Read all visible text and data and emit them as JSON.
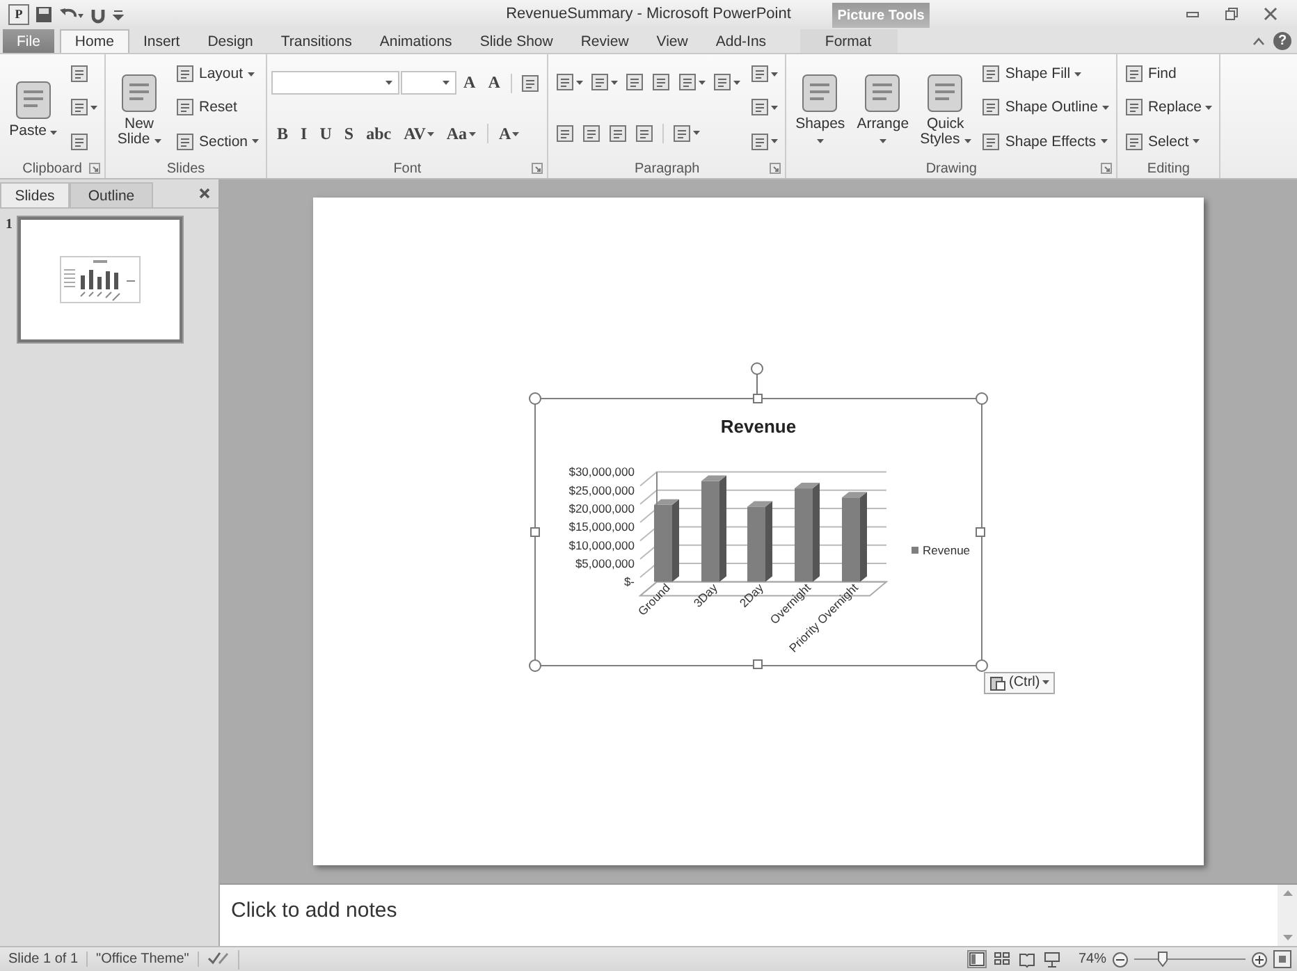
{
  "window": {
    "app_icon": "P",
    "title": "RevenueSummary - Microsoft PowerPoint",
    "context_label": "Picture Tools"
  },
  "tabs": [
    {
      "label": "File",
      "kind": "file",
      "selected": false
    },
    {
      "label": "Home",
      "kind": "normal",
      "selected": true
    },
    {
      "label": "Insert",
      "kind": "normal",
      "selected": false
    },
    {
      "label": "Design",
      "kind": "normal",
      "selected": false
    },
    {
      "label": "Transitions",
      "kind": "normal",
      "selected": false
    },
    {
      "label": "Animations",
      "kind": "normal",
      "selected": false
    },
    {
      "label": "Slide Show",
      "kind": "normal",
      "selected": false
    },
    {
      "label": "Review",
      "kind": "normal",
      "selected": false
    },
    {
      "label": "View",
      "kind": "normal",
      "selected": false
    },
    {
      "label": "Add-Ins",
      "kind": "normal",
      "selected": false
    },
    {
      "label": "Format",
      "kind": "contextual",
      "selected": false
    }
  ],
  "help": "?",
  "ribbon": {
    "groups": [
      {
        "label": "Clipboard",
        "launcher": true,
        "columns": [
          [
            [
              {
                "kind": "large",
                "label": "Paste",
                "dropdown": true
              }
            ]
          ],
          [
            [
              {
                "kind": "icon",
                "dropdown": false
              }
            ],
            [
              {
                "kind": "icon",
                "dropdown": true
              }
            ],
            [
              {
                "kind": "icon",
                "dropdown": false
              }
            ]
          ]
        ]
      },
      {
        "label": "Slides",
        "launcher": false,
        "columns": [
          [
            [
              {
                "kind": "large",
                "label": "New Slide",
                "dropdown": true
              }
            ]
          ],
          [
            [
              {
                "kind": "small",
                "label": "Layout",
                "dropdown": true
              }
            ],
            [
              {
                "kind": "small",
                "label": "Reset",
                "dropdown": false
              }
            ],
            [
              {
                "kind": "small",
                "label": "Section",
                "dropdown": true
              }
            ]
          ]
        ]
      },
      {
        "label": "Font",
        "launcher": true,
        "columns": [
          [
            [
              {
                "kind": "field",
                "dropdown": true
              },
              {
                "kind": "field",
                "dropdown": true
              },
              {
                "kind": "glyph",
                "glyph": "A",
                "dropdown": false
              },
              {
                "kind": "glyph",
                "glyph": "A",
                "dropdown": false
              },
              {
                "kind": "separator"
              },
              {
                "kind": "icon",
                "dropdown": false
              }
            ],
            [
              {
                "kind": "glyph",
                "glyph": "B",
                "dropdown": false
              },
              {
                "kind": "glyph",
                "glyph": "I",
                "dropdown": false
              },
              {
                "kind": "glyph",
                "glyph": "U",
                "dropdown": false
              },
              {
                "kind": "glyph",
                "glyph": "S",
                "dropdown": false
              },
              {
                "kind": "glyph",
                "glyph": "abc",
                "dropdown": false
              },
              {
                "kind": "glyph",
                "glyph": "AV",
                "dropdown": true
              },
              {
                "kind": "glyph",
                "glyph": "Aa",
                "dropdown": true
              },
              {
                "kind": "separator"
              },
              {
                "kind": "glyph",
                "glyph": "A",
                "dropdown": true
              }
            ]
          ]
        ]
      },
      {
        "label": "Paragraph",
        "launcher": true,
        "columns": [
          [
            [
              {
                "kind": "icon",
                "dropdown": true
              },
              {
                "kind": "icon",
                "dropdown": true
              },
              {
                "kind": "icon",
                "dropdown": false
              },
              {
                "kind": "icon",
                "dropdown": false
              },
              {
                "kind": "icon",
                "dropdown": true
              },
              {
                "kind": "icon",
                "dropdown": true
              }
            ],
            [
              {
                "kind": "icon",
                "dropdown": false
              },
              {
                "kind": "icon",
                "dropdown": false
              },
              {
                "kind": "icon",
                "dropdown": false
              },
              {
                "kind": "icon",
                "dropdown": false
              },
              {
                "kind": "separator"
              },
              {
                "kind": "icon",
                "dropdown": true
              }
            ]
          ],
          [
            [
              {
                "kind": "icon",
                "dropdown": true
              }
            ],
            [
              {
                "kind": "icon",
                "dropdown": true
              }
            ],
            [
              {
                "kind": "icon",
                "dropdown": true
              }
            ]
          ]
        ]
      },
      {
        "label": "Drawing",
        "launcher": true,
        "columns": [
          [
            [
              {
                "kind": "large",
                "label": "Shapes",
                "dropdown": true
              }
            ]
          ],
          [
            [
              {
                "kind": "large",
                "label": "Arrange",
                "dropdown": true
              }
            ]
          ],
          [
            [
              {
                "kind": "large",
                "label": "Quick Styles",
                "dropdown": true
              }
            ]
          ],
          [
            [
              {
                "kind": "small",
                "label": "Shape Fill",
                "dropdown": true
              }
            ],
            [
              {
                "kind": "small",
                "label": "Shape Outline",
                "dropdown": true
              }
            ],
            [
              {
                "kind": "small",
                "label": "Shape Effects",
                "dropdown": true
              }
            ]
          ]
        ]
      },
      {
        "label": "Editing",
        "launcher": false,
        "columns": [
          [
            [
              {
                "kind": "small",
                "label": "Find",
                "dropdown": false
              }
            ],
            [
              {
                "kind": "small",
                "label": "Replace",
                "dropdown": true
              }
            ],
            [
              {
                "kind": "small",
                "label": "Select",
                "dropdown": true
              }
            ]
          ]
        ]
      }
    ]
  },
  "slide_pane": {
    "tabs": [
      {
        "label": "Slides",
        "selected": true
      },
      {
        "label": "Outline",
        "selected": false
      }
    ],
    "thumbnails": [
      {
        "number": "1",
        "selected": true
      }
    ]
  },
  "chart": {
    "paste_options": "(Ctrl)",
    "chart_data": {
      "type": "bar",
      "title": "Revenue",
      "categories": [
        "Ground",
        "3Day",
        "2Day",
        "Overnight",
        "Priority Overnight"
      ],
      "series": [
        {
          "name": "Revenue",
          "color": "#7f7f7f",
          "values": [
            21000000,
            27500000,
            20500000,
            25500000,
            23000000
          ]
        }
      ],
      "ylim": [
        0,
        30000000
      ],
      "yticks": [
        {
          "value": 0,
          "label": "$-"
        },
        {
          "value": 5000000,
          "label": "$5,000,000"
        },
        {
          "value": 10000000,
          "label": "$10,000,000"
        },
        {
          "value": 15000000,
          "label": "$15,000,000"
        },
        {
          "value": 20000000,
          "label": "$20,000,000"
        },
        {
          "value": 25000000,
          "label": "$25,000,000"
        },
        {
          "value": 30000000,
          "label": "$30,000,000"
        }
      ]
    }
  },
  "notes": {
    "placeholder": "Click to add notes"
  },
  "status_bar": {
    "slide": "Slide 1 of 1",
    "theme": "\"Office Theme\"",
    "views": [
      {
        "kind": "normal",
        "selected": true
      },
      {
        "kind": "sorter",
        "selected": false
      },
      {
        "kind": "reading",
        "selected": false
      },
      {
        "kind": "slideshow",
        "selected": false
      }
    ],
    "zoom": "74%",
    "zoom_slider": {
      "level": 0.25
    }
  }
}
